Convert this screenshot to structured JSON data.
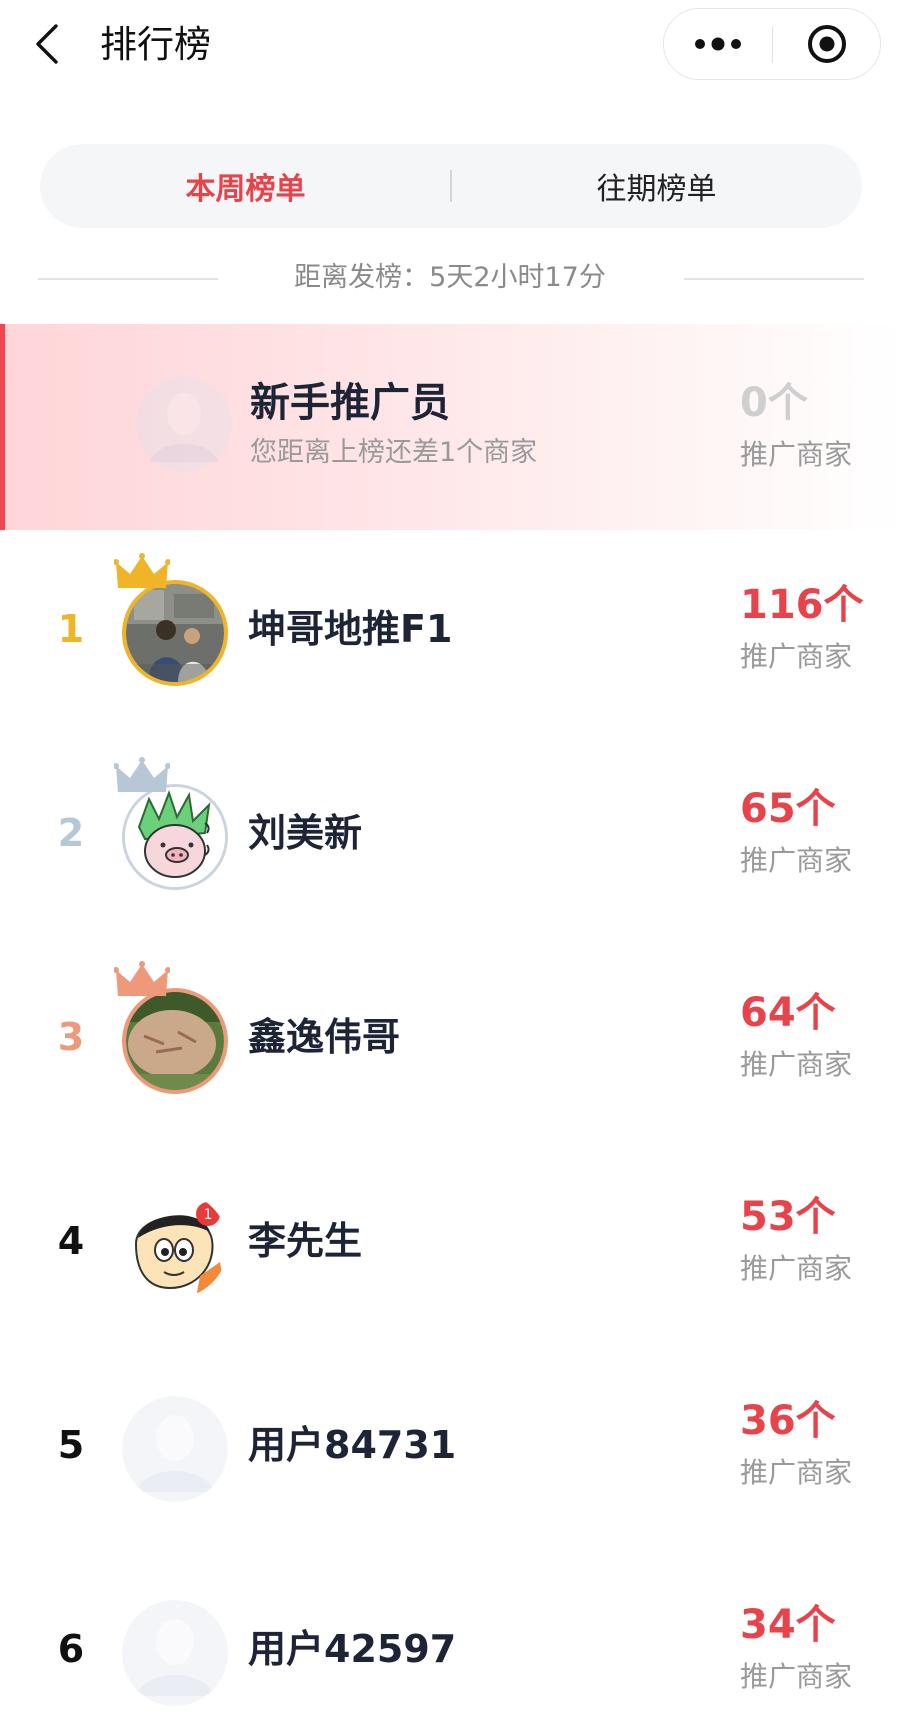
{
  "nav": {
    "title": "排行榜",
    "back_icon": "chevron-left-icon",
    "more_icon": "more-dots-icon",
    "close_icon": "target-close-icon"
  },
  "tabs": [
    {
      "label": "本周榜单",
      "active": true
    },
    {
      "label": "往期榜单",
      "active": false
    }
  ],
  "countdown": {
    "text": "距离发榜：5天2小时17分"
  },
  "my_rank": {
    "name": "新手推广员",
    "hint": "您距离上榜还差1个商家",
    "count": "0个",
    "unit": "推广商家"
  },
  "colors": {
    "accent": "#e8434a",
    "gold": "#f0b429",
    "silver": "#b7c7d6",
    "bronze": "#ee9a7a"
  },
  "ranking": [
    {
      "rank": "1",
      "name": "坤哥地推F1",
      "count": "116个",
      "unit": "推广商家",
      "crown": "gold"
    },
    {
      "rank": "2",
      "name": "刘美新",
      "count": "65个",
      "unit": "推广商家",
      "crown": "silver"
    },
    {
      "rank": "3",
      "name": "鑫逸伟哥",
      "count": "64个",
      "unit": "推广商家",
      "crown": "bronze"
    },
    {
      "rank": "4",
      "name": "李先生",
      "count": "53个",
      "unit": "推广商家",
      "crown": ""
    },
    {
      "rank": "5",
      "name": "用户84731",
      "count": "36个",
      "unit": "推广商家",
      "crown": ""
    },
    {
      "rank": "6",
      "name": "用户42597",
      "count": "34个",
      "unit": "推广商家",
      "crown": ""
    }
  ]
}
